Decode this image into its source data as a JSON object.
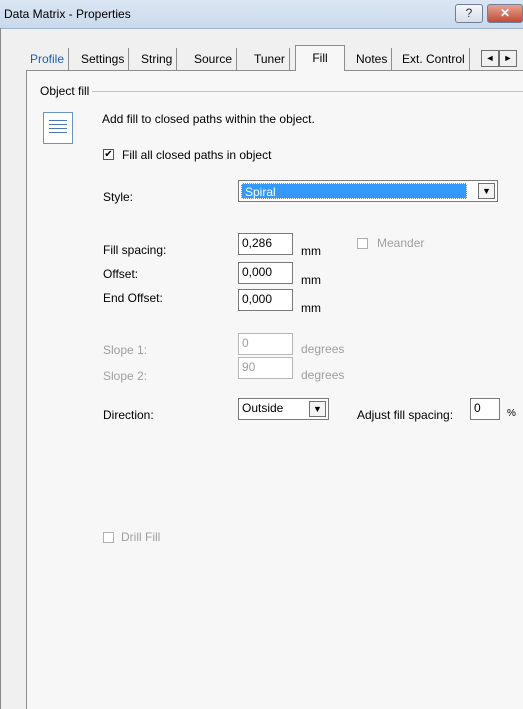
{
  "window": {
    "title": "Data Matrix - Properties",
    "help_label": "?",
    "close_label": "✕"
  },
  "tabs": [
    {
      "label": "Profile"
    },
    {
      "label": "Settings"
    },
    {
      "label": "String"
    },
    {
      "label": "Source"
    },
    {
      "label": "Tuner"
    },
    {
      "label": "Fill"
    },
    {
      "label": "Notes"
    },
    {
      "label": "Ext. Control"
    }
  ],
  "tab_scroll": {
    "left": "◄",
    "right": "►"
  },
  "group": {
    "label": "Object fill",
    "description": "Add fill to closed paths within the object."
  },
  "fill_all": {
    "label": "Fill all closed paths in object",
    "checked": "✔"
  },
  "style": {
    "label": "Style:",
    "value": "Spiral"
  },
  "fill_spacing": {
    "label": "Fill spacing:",
    "value": "0,286",
    "unit": "mm"
  },
  "meander": {
    "label": "Meander"
  },
  "offset": {
    "label": "Offset:",
    "value": "0,000",
    "unit": "mm"
  },
  "end_offset": {
    "label": "End Offset:",
    "value": "0,000",
    "unit": "mm"
  },
  "slope1": {
    "label": "Slope 1:",
    "value": "0",
    "unit": "degrees"
  },
  "slope2": {
    "label": "Slope 2:",
    "value": "90",
    "unit": "degrees"
  },
  "direction": {
    "label": "Direction:",
    "value": "Outside"
  },
  "adjust": {
    "label": "Adjust fill spacing:",
    "value": "0",
    "unit": "%"
  },
  "drill_fill": {
    "label": "Drill Fill"
  },
  "arrow_down": "▼"
}
